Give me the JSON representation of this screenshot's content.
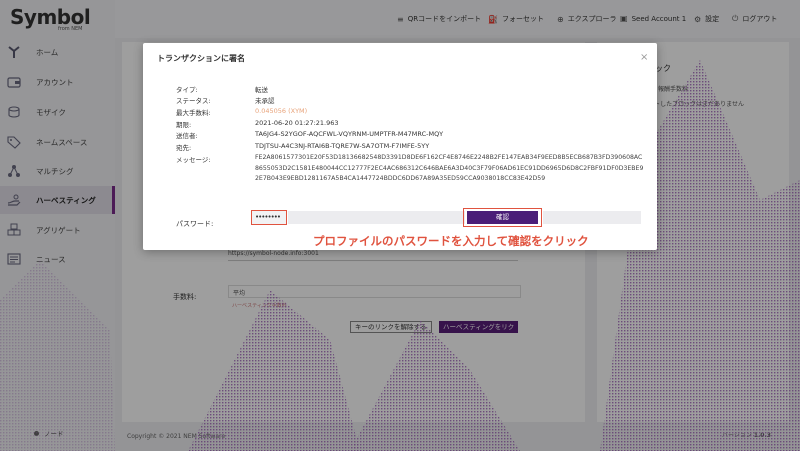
{
  "brand": {
    "name": "Symbol",
    "sub": "from NEM"
  },
  "sidebar": {
    "items": [
      {
        "label": "ホーム",
        "icon": "home-icon"
      },
      {
        "label": "アカウント",
        "icon": "wallet-icon"
      },
      {
        "label": "モザイク",
        "icon": "coins-icon"
      },
      {
        "label": "ネームスペース",
        "icon": "tag-icon"
      },
      {
        "label": "マルチシグ",
        "icon": "multisig-icon"
      },
      {
        "label": "ハーベスティング",
        "icon": "harvest-icon",
        "active": true
      },
      {
        "label": "アグリゲート",
        "icon": "cubes-icon"
      },
      {
        "label": "ニュース",
        "icon": "news-icon"
      }
    ],
    "node_label": "ノード"
  },
  "topbar": {
    "import_qr": "QRコードをインポート",
    "faucet": "フォーセット",
    "explorer": "エクスプローラ",
    "account": "Seed Account 1",
    "settings": "設定",
    "logout": "ログアウト"
  },
  "background": {
    "right_title": "されたブロック",
    "right_col": "報酬手数料",
    "right_row": "ハーベストしたブロックはまだありません",
    "node_select": "https://symbol-node.info:3001",
    "fee_label": "手数料:",
    "fee_value": "平均",
    "fee_sub": "ハーベスティング手数料",
    "unlink_button": "キーのリンクを解除する",
    "harvest_button": "ハーベスティングをリク",
    "copyright": "Copyright © 2021 NEM Software",
    "version_label": "バージョン",
    "version": "1.0.3"
  },
  "modal": {
    "title": "トランザクションに署名",
    "fields": [
      {
        "label": "タイプ:",
        "value": "転送"
      },
      {
        "label": "ステータス:",
        "value": "未承認"
      },
      {
        "label": "最大手数料:",
        "value": "0.045056 (XYM)"
      },
      {
        "label": "期限:",
        "value": "2021-06-20 01:27:21.963"
      },
      {
        "label": "送信者:",
        "value": "TA6JG4-S2YGOF-AQCFWL-VQYRNM-UMPTFR-M47MRC-MQY"
      },
      {
        "label": "宛先:",
        "value": "TDJTSU-A4C3NJ-RTAI6B-TQRE7W-SA7OTM-F7IMFE-5YY"
      },
      {
        "label": "メッセージ:",
        "value": "FE2A8061577301E20F53D18136682548D3391D8DE6F162CF4E8746E2248B2FE147EAB34F9EED8B5ECB687B3FD390608AC8655053D2C1581E480044CC12777F2EC4AC686312C646BAE6A3D40C3F79F06AD61EC91DD6965D6D8C2FBF91DF0D3EBE92E7B043E9EBD1281167A5B4CA1447724BDDC6DD67A89A35ED59CCA9038018CC83E42D59"
      }
    ],
    "password_label": "パスワード:",
    "password_value": "••••••••",
    "confirm_button": "確認",
    "close_symbol": "×"
  },
  "annotation": "プロファイルのパスワードを入力して確認をクリック",
  "colors": {
    "accent": "#4a1e78",
    "brand": "#7b2d8b",
    "highlight": "#e0533f",
    "fee": "#e8a37a"
  }
}
